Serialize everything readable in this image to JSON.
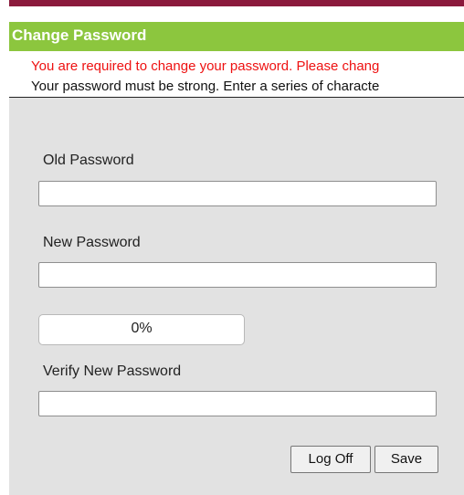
{
  "header": {
    "title": "Change Password",
    "accent_color": "#8cc63e",
    "band_color": "#8b1a3c"
  },
  "messages": {
    "required": "You are required to change your password. Please chang",
    "strength_hint": "Your password must be strong. Enter a series of characte"
  },
  "form": {
    "old_password_label": "Old Password",
    "old_password_value": "",
    "new_password_label": "New Password",
    "new_password_value": "",
    "strength_meter": {
      "text": "0%",
      "value_percent": 0
    },
    "verify_password_label": "Verify New Password",
    "verify_password_value": ""
  },
  "actions": {
    "log_off_label": "Log Off",
    "save_label": "Save"
  }
}
